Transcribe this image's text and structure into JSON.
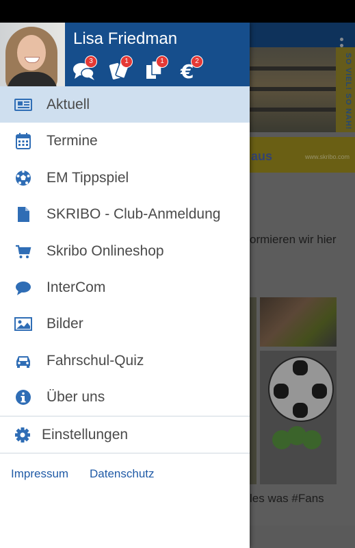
{
  "user": {
    "name": "Lisa Friedman"
  },
  "header_icons": [
    {
      "name": "chat-bubbles-icon",
      "badge": "3"
    },
    {
      "name": "tickets-icon",
      "badge": "1"
    },
    {
      "name": "documents-icon",
      "badge": "1"
    },
    {
      "name": "euro-icon",
      "badge": "2"
    }
  ],
  "menu": {
    "items": [
      {
        "label": "Aktuell",
        "icon": "newspaper-icon",
        "active": true
      },
      {
        "label": "Termine",
        "icon": "calendar-icon"
      },
      {
        "label": "EM Tippspiel",
        "icon": "soccer-ball-icon"
      },
      {
        "label": "SKRIBO - Club-Anmeldung",
        "icon": "document-icon"
      },
      {
        "label": "Skribo Onlineshop",
        "icon": "shopping-cart-icon"
      },
      {
        "label": "InterCom",
        "icon": "chat-bubble-icon"
      },
      {
        "label": "Bilder",
        "icon": "image-icon"
      },
      {
        "label": "Fahrschul-Quiz",
        "icon": "car-icon"
      },
      {
        "label": "Über uns",
        "icon": "info-icon"
      }
    ],
    "settings_label": "Einstellungen"
  },
  "footer": {
    "impressum": "Impressum",
    "datenschutz": "Datenschutz"
  },
  "background": {
    "banner_side_text": "SO VIEL! SO NAH!",
    "banner_text": "aus",
    "banner_url": "www.skribo.com",
    "text_line1": "ormieren wir hier",
    "text_line2": "les was #Fans"
  },
  "colors": {
    "primary": "#164e8c",
    "active_bg": "#cfdfef",
    "icon": "#2f6db5",
    "badge": "#e53935",
    "link": "#1f5aa6"
  }
}
